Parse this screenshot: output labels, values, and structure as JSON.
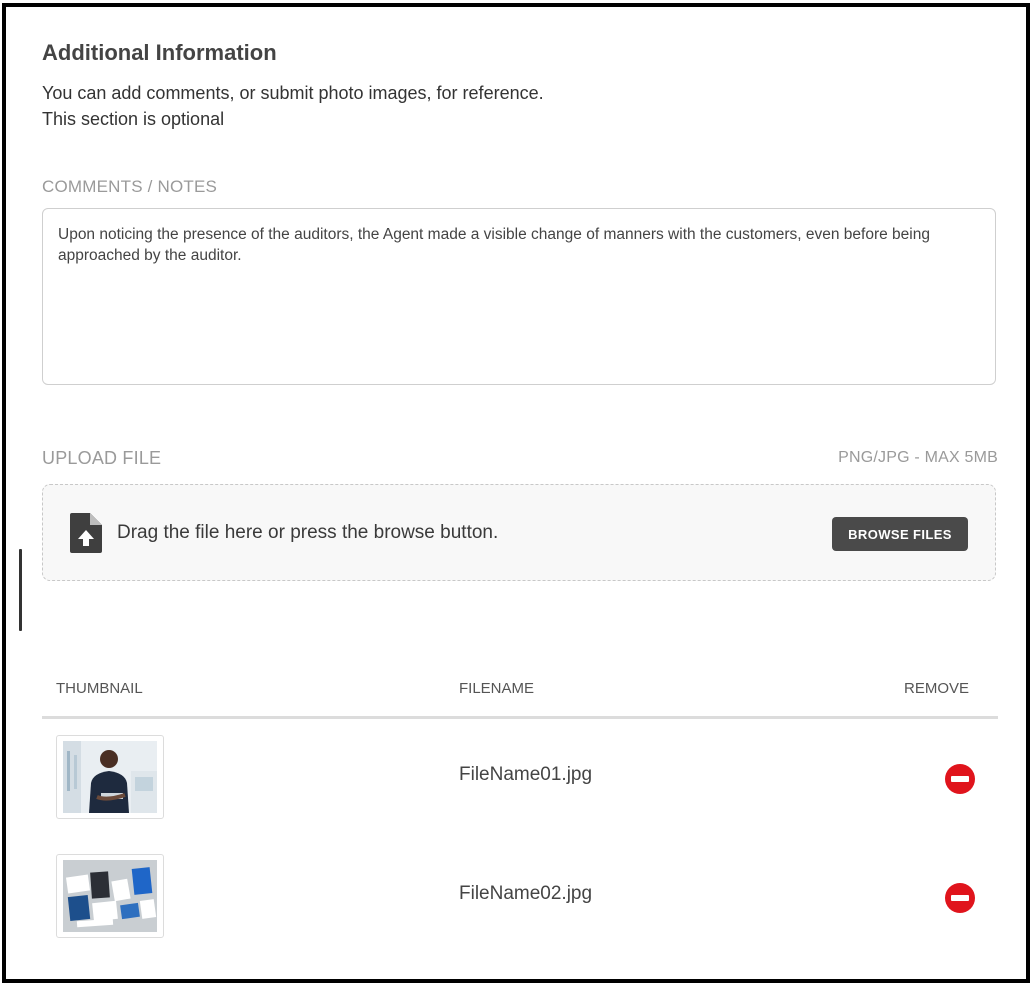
{
  "section": {
    "title": "Additional Information",
    "description_line1": "You can add comments, or submit photo images, for reference.",
    "description_line2": "This section is optional"
  },
  "comments": {
    "label": "COMMENTS / NOTES",
    "value": "Upon noticing the presence of the auditors, the Agent made a visible change of manners with the customers, even before being approached by the auditor."
  },
  "upload": {
    "label": "UPLOAD FILE",
    "hint": "PNG/JPG - MAX 5MB",
    "drop_text": "Drag the file here or press the browse button.",
    "browse_label": "BROWSE FILES",
    "icon": "file-upload-icon"
  },
  "table": {
    "headers": {
      "thumbnail": "THUMBNAIL",
      "filename": "FILENAME",
      "remove": "REMOVE"
    },
    "rows": [
      {
        "filename": "FileName01.jpg",
        "thumbnail": "photo-of-man-in-office",
        "remove_icon": "remove-circle-icon"
      },
      {
        "filename": "FileName02.jpg",
        "thumbnail": "photo-of-stationery-mockup",
        "remove_icon": "remove-circle-icon"
      }
    ]
  },
  "colors": {
    "accent_remove": "#e0141c",
    "button_dark": "#4a4a4a",
    "label_gray": "#9a9a9a"
  }
}
